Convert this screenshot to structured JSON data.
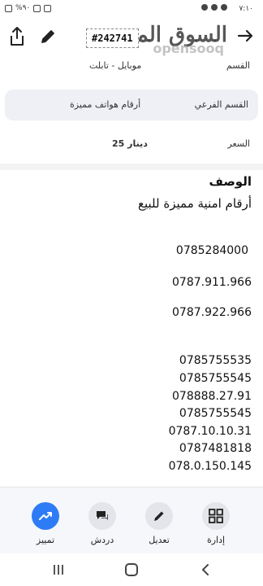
{
  "status_bar": {
    "time": "٧:١٠",
    "left_text": "%٩٠"
  },
  "top_bar": {
    "ad_id": "#242741",
    "logo_text": "السوق المفتوح",
    "logo_sub": "opensooq"
  },
  "details": {
    "section_label": "القسم",
    "section_value": "موبايل - تابلت",
    "subsection_label": "القسم الفرعي",
    "subsection_value": "أرقام هواتف مميزة",
    "price_label": "السعر",
    "price_value": "25 دينار"
  },
  "description": {
    "title": "الوصف",
    "lines": [
      "أرقام امنية مميزة للبيع",
      "0785284000",
      "0787.911.966",
      "0787.922.966",
      "0785755535",
      "0785755545",
      "078888.27.91",
      "0785755545",
      "0787.10.10.31",
      "0787481818",
      "078.0.150.145"
    ]
  },
  "actions": {
    "manage": "إدارة",
    "edit": "تعديل",
    "chat": "دردش",
    "promote": "تمييز",
    "accent_color": "#2d7cf6"
  }
}
